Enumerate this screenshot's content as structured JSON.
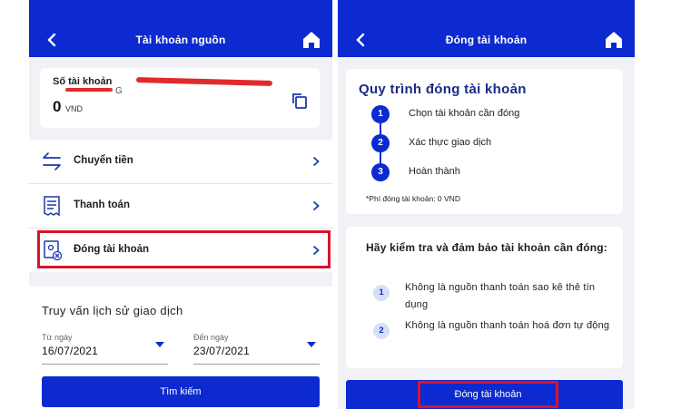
{
  "left_screen": {
    "header": {
      "title": "Tài khoản nguồn"
    },
    "account": {
      "label": "Số tài khoản",
      "number_suffix": "G",
      "balance": "0",
      "currency": "VND"
    },
    "menu": [
      {
        "label": "Chuyển tiền",
        "icon": "transfer-icon"
      },
      {
        "label": "Thanh toán",
        "icon": "bill-icon"
      },
      {
        "label": "Đóng tài khoản",
        "icon": "close-account-icon"
      }
    ],
    "query": {
      "title": "Truy vấn lịch sử giao dịch",
      "from_label": "Từ ngày",
      "from_value": "16/07/2021",
      "to_label": "Đến ngày",
      "to_value": "23/07/2021",
      "search_label": "Tìm kiếm"
    }
  },
  "right_screen": {
    "header": {
      "title": "Đóng tài khoản"
    },
    "process": {
      "title": "Quy trình đóng tài khoản",
      "steps": [
        {
          "num": "1",
          "text": "Chọn tài khoản cần đóng"
        },
        {
          "num": "2",
          "text": "Xác thực giao dịch"
        },
        {
          "num": "3",
          "text": "Hoàn thành"
        }
      ],
      "fee_note": "*Phí đóng tài khoản: 0 VND"
    },
    "checks": {
      "title": "Hãy kiểm tra và đảm bảo tài khoản cần đóng:",
      "items": [
        {
          "num": "1",
          "text": "Không là nguồn thanh toán sao kê thẻ tín dụng"
        },
        {
          "num": "2",
          "text": "Không là nguồn thanh toán hoá đơn tự động"
        }
      ]
    },
    "close_button_label": "Đóng tài khoản"
  },
  "colors": {
    "primary": "#0c2ad0",
    "highlight": "#d7142b",
    "redaction": "#e12a2a"
  }
}
